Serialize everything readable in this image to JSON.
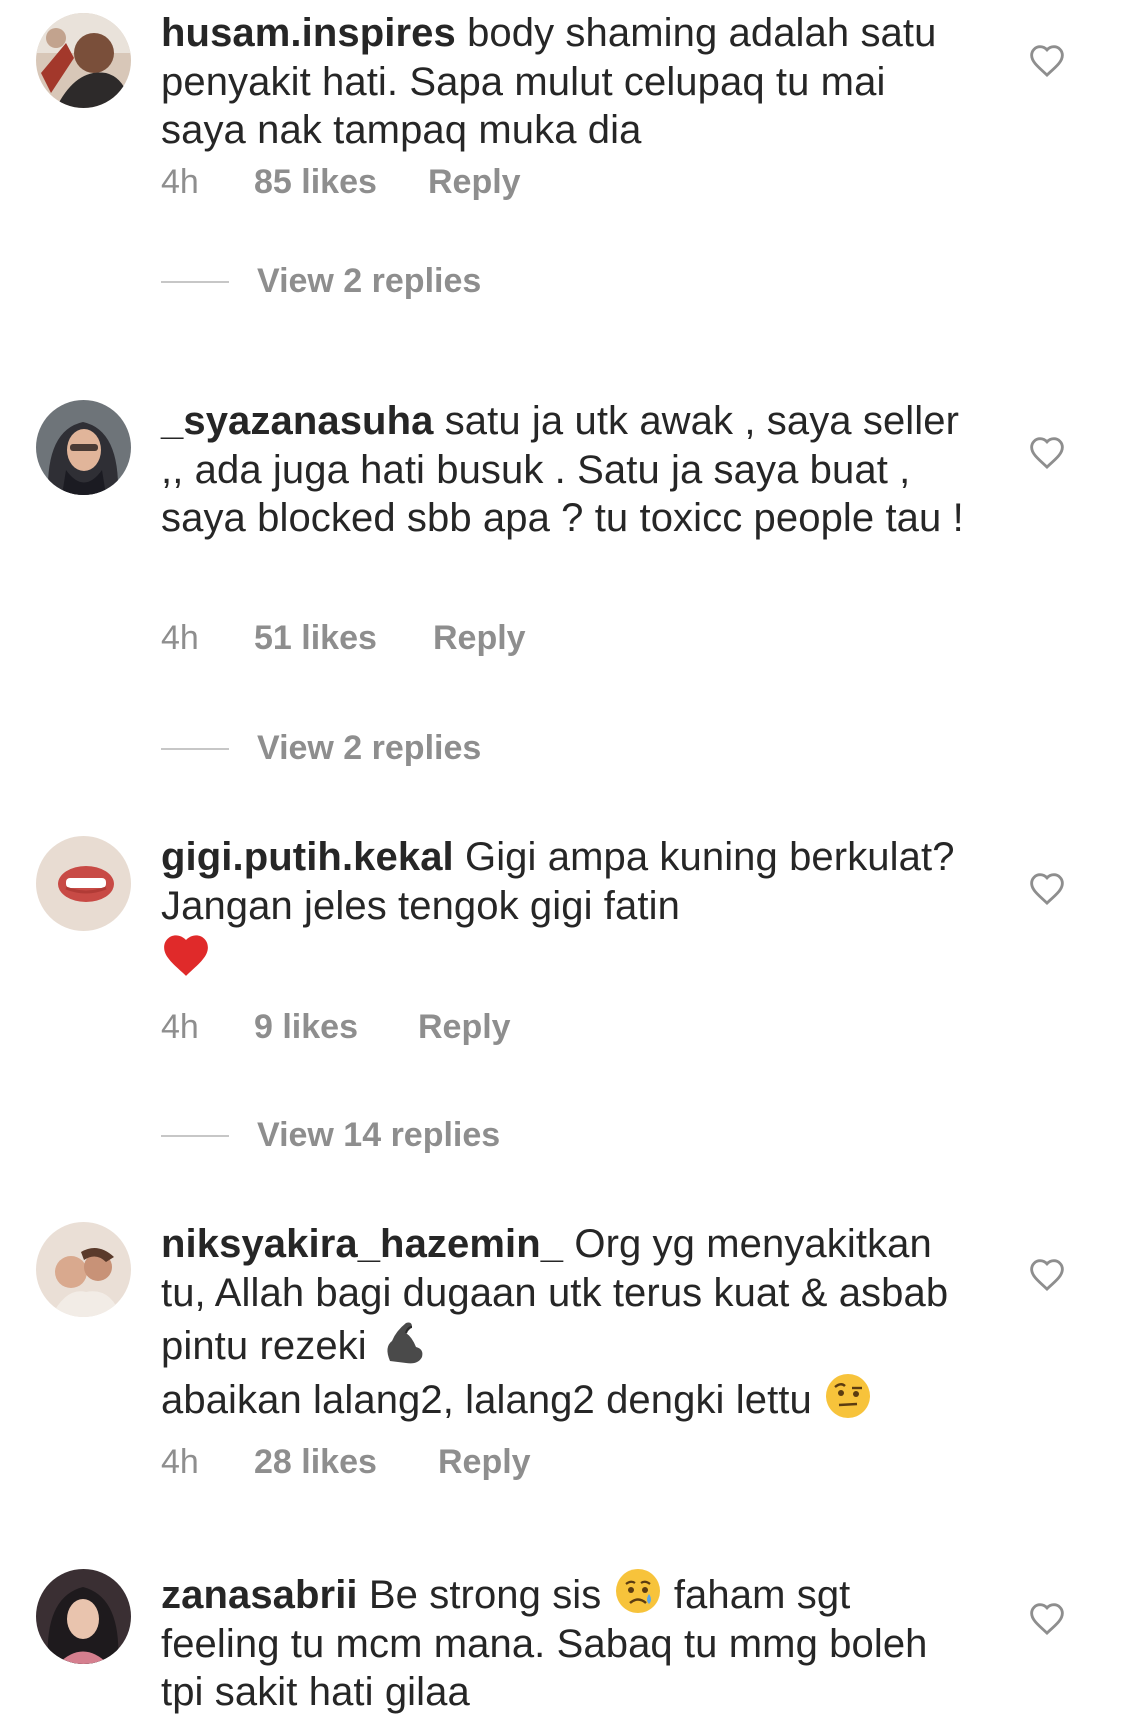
{
  "comments": [
    {
      "username": "husam.inspires",
      "text": "body shaming adalah satu penyakit hati. Sapa mulut celupaq tu mai saya nak tampaq muka dia",
      "time": "4h",
      "likes": "85 likes",
      "reply": "Reply",
      "view_replies": "View 2 replies"
    },
    {
      "username": "_syazanasuha",
      "text": "satu ja utk awak , saya seller ,, ada juga hati busuk .  Satu ja saya buat , saya blocked sbb apa ? tu toxicc people tau !",
      "time": "4h",
      "likes": "51 likes",
      "reply": "Reply",
      "view_replies": "View 2 replies"
    },
    {
      "username": "gigi.putih.kekal",
      "text": "Gigi ampa kuning berkulat? Jangan jeles tengok gigi fatin",
      "emoji": "❤️",
      "time": "4h",
      "likes": "9 likes",
      "reply": "Reply",
      "view_replies": "View 14 replies"
    },
    {
      "username": "niksyakira_hazemin_",
      "text_1": "Org yg menyakitkan tu, Allah bagi dugaan utk terus kuat & asbab pintu rezeki",
      "emoji_1": "💪",
      "text_2": "abaikan lalang2, lalang2 dengki lettu",
      "emoji_2": "🤨",
      "time": "4h",
      "likes": "28 likes",
      "reply": "Reply"
    },
    {
      "username": "zanasabrii",
      "text_1": "Be strong sis",
      "emoji_1": "😢",
      "text_2": "faham sgt feeling tu mcm mana. Sabaq tu mmg boleh tpi sakit hati gilaa"
    }
  ]
}
